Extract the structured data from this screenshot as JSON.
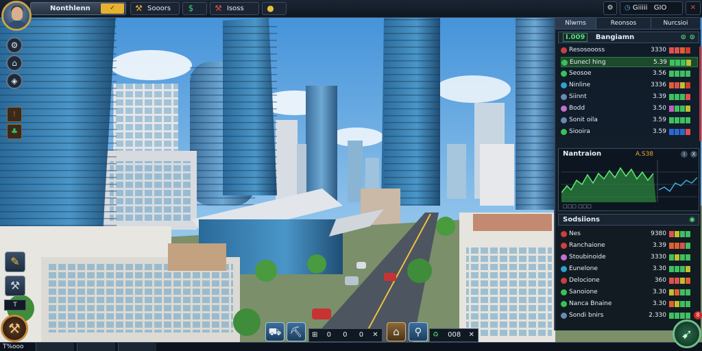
{
  "player": {
    "name": "Nonthlenn",
    "level_badge": "✓"
  },
  "top_resources": [
    {
      "icon": "wrench-icon",
      "glyph": "⚒",
      "value": "Sooors",
      "chip": ""
    },
    {
      "icon": "cash-icon",
      "glyph": "$",
      "value": "",
      "chip": ""
    },
    {
      "icon": "hammer-icon",
      "glyph": "⚒",
      "value": "Isoss",
      "chip": ""
    },
    {
      "icon": "coin-icon",
      "glyph": "●",
      "value": "",
      "chip": ""
    }
  ],
  "top_right": {
    "clock": "Giiiii",
    "counter": "GIO"
  },
  "left_toolbar": {
    "buttons": [
      "gear-icon",
      "home-icon",
      "map-icon"
    ],
    "tool_label": "T"
  },
  "bottom_bar": {
    "left_text": "T%ooo",
    "action_values": [
      "0",
      "0",
      "0",
      "008"
    ]
  },
  "panel": {
    "tabs": [
      "Nlwrns",
      "Reonsos",
      "Nurcsioi"
    ],
    "header_value": "I.009",
    "header_title": "Bangiamn",
    "list": [
      {
        "name": "Resosoooss",
        "value": "3330",
        "color": "#c94040",
        "bars": [
          "#e05050",
          "#e05050",
          "#e06030",
          "#d04030"
        ]
      },
      {
        "name": "Eunecl hing",
        "value": "5.39",
        "color": "#3bbf5a",
        "bars": [
          "#40c060",
          "#40c060",
          "#40c060",
          "#c0c030"
        ]
      },
      {
        "name": "Seosoe",
        "value": "3.56",
        "color": "#3bbf5a",
        "bars": [
          "#40c060",
          "#40c060",
          "#40c060",
          "#40c060"
        ]
      },
      {
        "name": "Ninline",
        "value": "3336",
        "color": "#2fa0d0",
        "bars": [
          "#e06030",
          "#e05050",
          "#c0c030",
          "#d04030"
        ]
      },
      {
        "name": "Siinnt",
        "value": "3.39",
        "color": "#6a8ab0",
        "bars": [
          "#40c060",
          "#40c060",
          "#40c060",
          "#e05050"
        ]
      },
      {
        "name": "Bodd",
        "value": "3.50",
        "color": "#c070d0",
        "bars": [
          "#c060c0",
          "#40c060",
          "#40c060",
          "#c0c030"
        ]
      },
      {
        "name": "Sonit oila",
        "value": "3.59",
        "color": "#6a8ab0",
        "bars": [
          "#40c060",
          "#40c060",
          "#40c060",
          "#40c060"
        ]
      },
      {
        "name": "Siooira",
        "value": "3.59",
        "color": "#3bbf5a",
        "bars": [
          "#2a6ad0",
          "#2a6ad0",
          "#2a6ad0",
          "#e05050"
        ]
      }
    ],
    "chart": {
      "title": "Nantraion",
      "value": "A.S38",
      "btn1": "I",
      "btn2": "X"
    },
    "stats_title": "Sodsiions",
    "stats": [
      {
        "name": "Nes",
        "value": "9380",
        "color": "#c94040",
        "bars": [
          "#e05050",
          "#c0c030",
          "#40c060",
          "#40c060"
        ]
      },
      {
        "name": "Ranchaione",
        "value": "3.39",
        "color": "#d04040",
        "bars": [
          "#e06030",
          "#e06030",
          "#e05050",
          "#40c060"
        ]
      },
      {
        "name": "Stoubinoide",
        "value": "3330",
        "color": "#c070d0",
        "bars": [
          "#40c060",
          "#c0c030",
          "#40c060",
          "#40c060"
        ]
      },
      {
        "name": "Eunelone",
        "value": "3.30",
        "color": "#2fa0d0",
        "bars": [
          "#40c060",
          "#40c060",
          "#40c060",
          "#c0c030"
        ]
      },
      {
        "name": "Delocione",
        "value": "360",
        "color": "#c94040",
        "bars": [
          "#e05050",
          "#e05050",
          "#c0c030",
          "#e06030"
        ]
      },
      {
        "name": "Sanoione",
        "value": "3.30",
        "color": "#3bbf5a",
        "bars": [
          "#c0c030",
          "#e06030",
          "#40c060",
          "#40c060"
        ]
      },
      {
        "name": "Nanca Bnaine",
        "value": "3.30",
        "color": "#3bbf5a",
        "bars": [
          "#e06030",
          "#c0c030",
          "#40c060",
          "#40c060"
        ]
      },
      {
        "name": "Sondi bnirs",
        "value": "2.330",
        "color": "#6a8ab0",
        "bars": [
          "#40c060",
          "#40c060",
          "#40c060",
          "#40c060"
        ]
      }
    ],
    "notif_count": "8"
  },
  "colors": {
    "accent": "#c9a24a",
    "positive": "#40c060",
    "negative": "#e05050",
    "sky": "#5aa8e8"
  }
}
